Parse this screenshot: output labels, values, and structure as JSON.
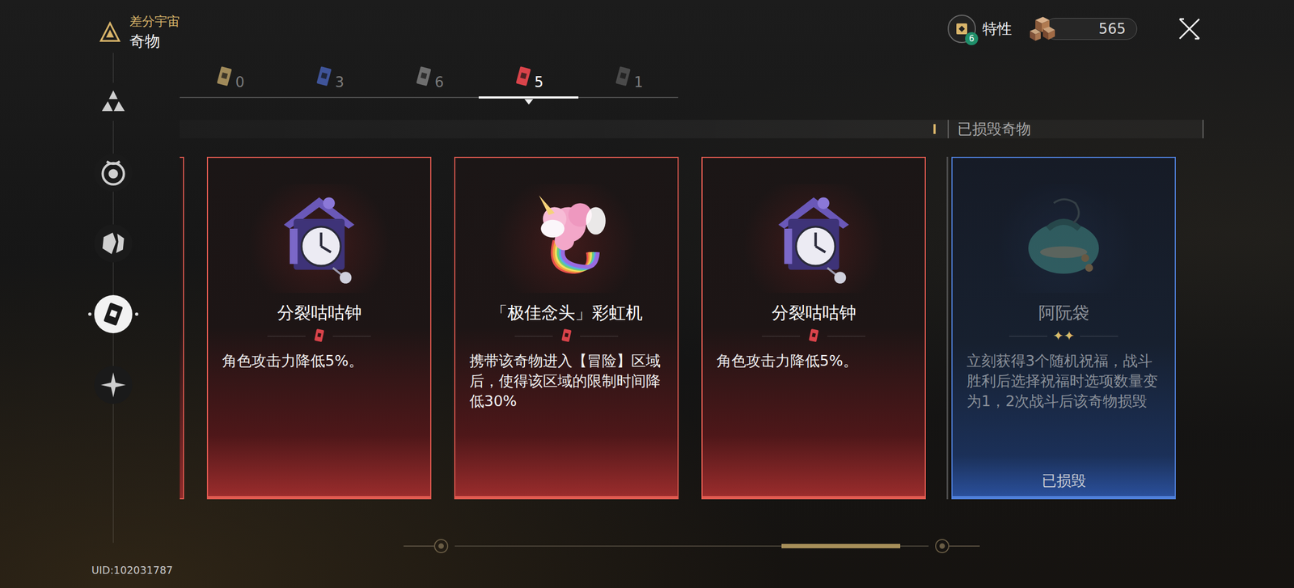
{
  "header": {
    "mode": "差分宇宙",
    "title": "奇物"
  },
  "sidebar": {
    "items": [
      {
        "kind": "emblem",
        "selected": false
      },
      {
        "kind": "orb",
        "selected": false
      },
      {
        "kind": "shard",
        "selected": false
      },
      {
        "kind": "curio",
        "selected": true
      },
      {
        "kind": "star",
        "selected": false
      }
    ]
  },
  "uid": "UID:102031787",
  "top_bar": {
    "traits": {
      "label": "特性",
      "badge": "6"
    },
    "currency": {
      "value": "565"
    }
  },
  "tabs": [
    {
      "count": "0",
      "color": "#a08a5a",
      "selected": false
    },
    {
      "count": "3",
      "color": "#3f5499",
      "selected": false
    },
    {
      "count": "6",
      "color": "#6e6e6e",
      "selected": false
    },
    {
      "count": "5",
      "color": "#d9434a",
      "selected": true
    },
    {
      "count": "1",
      "color": "#4a4a4a",
      "selected": false
    }
  ],
  "section": {
    "destroyed_label": "已损毁奇物"
  },
  "cards": [
    {
      "name": "分裂咕咕钟",
      "description": "角色攻击力降低5%。",
      "kind": "clock",
      "rarity": "negative",
      "destroyed": false
    },
    {
      "name": "「极佳念头」彩虹机",
      "description": "携带该奇物进入【冒险】区域后，使得该区域的限制时间降低30%",
      "kind": "rainbow",
      "rarity": "negative",
      "destroyed": false
    },
    {
      "name": "分裂咕咕钟",
      "description": "角色攻击力降低5%。",
      "kind": "clock",
      "rarity": "negative",
      "destroyed": false
    },
    {
      "name": "阿阮袋",
      "description": "立刻获得3个随机祝福，战斗胜利后选择祝福时选项数量变为1，2次战斗后该奇物损毁",
      "kind": "bag",
      "rarity": "positive",
      "rarity_mark": "✦✦",
      "destroyed": true,
      "status": "已损毁"
    }
  ],
  "scrollbar": {
    "start": 0.69,
    "size": 0.25
  }
}
